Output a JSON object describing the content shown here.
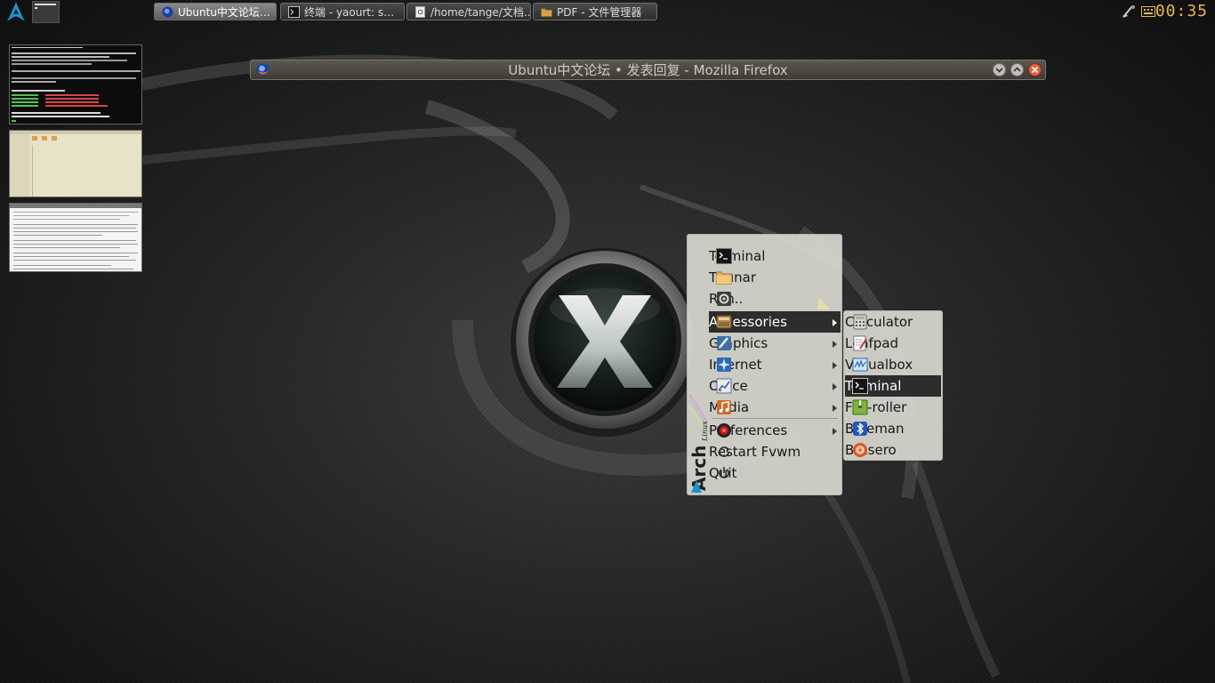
{
  "panel": {
    "tasks": [
      {
        "label": "Ubuntu中文论坛…",
        "active": true
      },
      {
        "label": "终端 - yaourt: s…",
        "active": false
      },
      {
        "label": "/home/tange/文档…",
        "active": false
      },
      {
        "label": "PDF - 文件管理器",
        "active": false
      }
    ],
    "clock": "00:35"
  },
  "firefox": {
    "title": "Ubuntu中文论坛 • 发表回复 - Mozilla Firefox"
  },
  "menu": {
    "items": [
      {
        "label": "Terminal",
        "icon": "terminal-icon"
      },
      {
        "label": "Thunar",
        "icon": "folder-icon"
      },
      {
        "label": "Run..",
        "icon": "run-icon"
      },
      {
        "label": "Accessories",
        "icon": "accessories-icon",
        "submenu": true,
        "selected": true
      },
      {
        "label": "Graphics",
        "icon": "graphics-icon",
        "submenu": true
      },
      {
        "label": "Internet",
        "icon": "internet-icon",
        "submenu": true
      },
      {
        "label": "Office",
        "icon": "office-icon",
        "submenu": true
      },
      {
        "label": "Media",
        "icon": "media-icon",
        "submenu": true
      },
      {
        "label": "Preferences",
        "icon": "preferences-icon",
        "submenu": true
      },
      {
        "label": "Restart Fvwm",
        "icon": "restart-icon"
      },
      {
        "label": "Quit",
        "icon": "power-icon"
      }
    ],
    "sidebar_text": "Arch",
    "sidebar_small": "Linux"
  },
  "submenu": {
    "items": [
      {
        "label": "Calculator",
        "icon": "calculator-icon"
      },
      {
        "label": "Leafpad",
        "icon": "leafpad-icon"
      },
      {
        "label": "Virtualbox",
        "icon": "virtualbox-icon"
      },
      {
        "label": "Terminal",
        "icon": "terminal-icon",
        "selected": true
      },
      {
        "label": "File-roller",
        "icon": "file-roller-icon"
      },
      {
        "label": "Blueman",
        "icon": "bluetooth-icon"
      },
      {
        "label": "Brasero",
        "icon": "brasero-icon"
      }
    ]
  },
  "colors": {
    "clock": "#e8b84a",
    "menu_bg": "#d7d7d0",
    "selection": "#2d2d2d",
    "arch_blue": "#1793d1"
  }
}
